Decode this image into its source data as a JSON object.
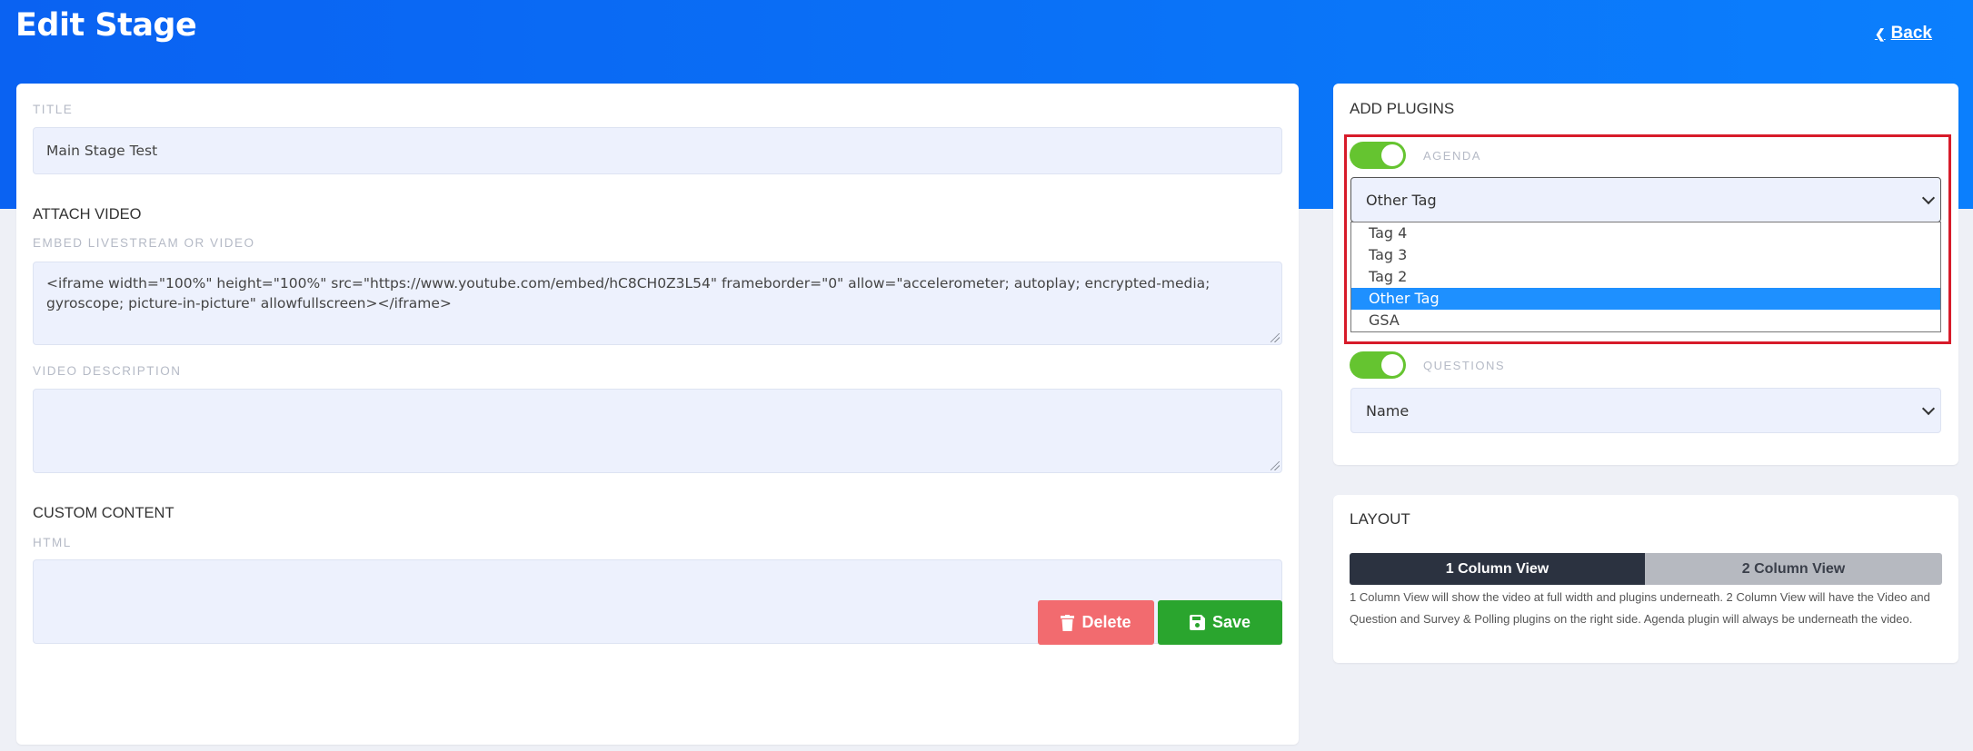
{
  "header": {
    "title": "Edit Stage",
    "back_label": "Back"
  },
  "form": {
    "title_label": "TITLE",
    "title_value": "Main Stage Test",
    "attach_video_heading": "ATTACH VIDEO",
    "embed_label": "EMBED LIVESTREAM OR VIDEO",
    "embed_value": "<iframe width=\"100%\" height=\"100%\" src=\"https://www.youtube.com/embed/hC8CH0Z3L54\" frameborder=\"0\" allow=\"accelerometer; autoplay; encrypted-media; gyroscope; picture-in-picture\" allowfullscreen></iframe>",
    "video_description_label": "VIDEO DESCRIPTION",
    "video_description_value": "",
    "custom_content_heading": "CUSTOM CONTENT",
    "html_label": "HTML",
    "html_value": ""
  },
  "actions": {
    "delete_label": "Delete",
    "save_label": "Save",
    "delete_color": "#f26b6f",
    "save_color": "#2aa52e"
  },
  "plugins": {
    "title": "ADD PLUGINS",
    "agenda": {
      "label": "AGENDA",
      "enabled": true,
      "selected": "Other Tag",
      "options": [
        "Tag 4",
        "Tag 3",
        "Tag 2",
        "Other Tag",
        "GSA"
      ]
    },
    "questions": {
      "label": "QUESTIONS",
      "enabled": true,
      "selected": "Name"
    }
  },
  "layout": {
    "title": "LAYOUT",
    "option_1": "1 Column View",
    "option_2": "2 Column View",
    "active_option": "1 Column View",
    "description": "1 Column View will show the video at full width and plugins underneath. 2 Column View will have the Video and Question and Survey & Polling plugins on the right side. Agenda plugin will always be underneath the video."
  },
  "colors": {
    "header_gradient_start": "#0a62f2",
    "header_gradient_end": "#0b7ffd",
    "toggle_on": "#65c430",
    "selected_option": "#1e90ff",
    "highlight_border": "#d71b2a"
  },
  "icons": {
    "back": "chevron-left-icon",
    "delete": "trash-icon",
    "save": "floppy-disk-icon",
    "select": "chevron-down-icon"
  }
}
